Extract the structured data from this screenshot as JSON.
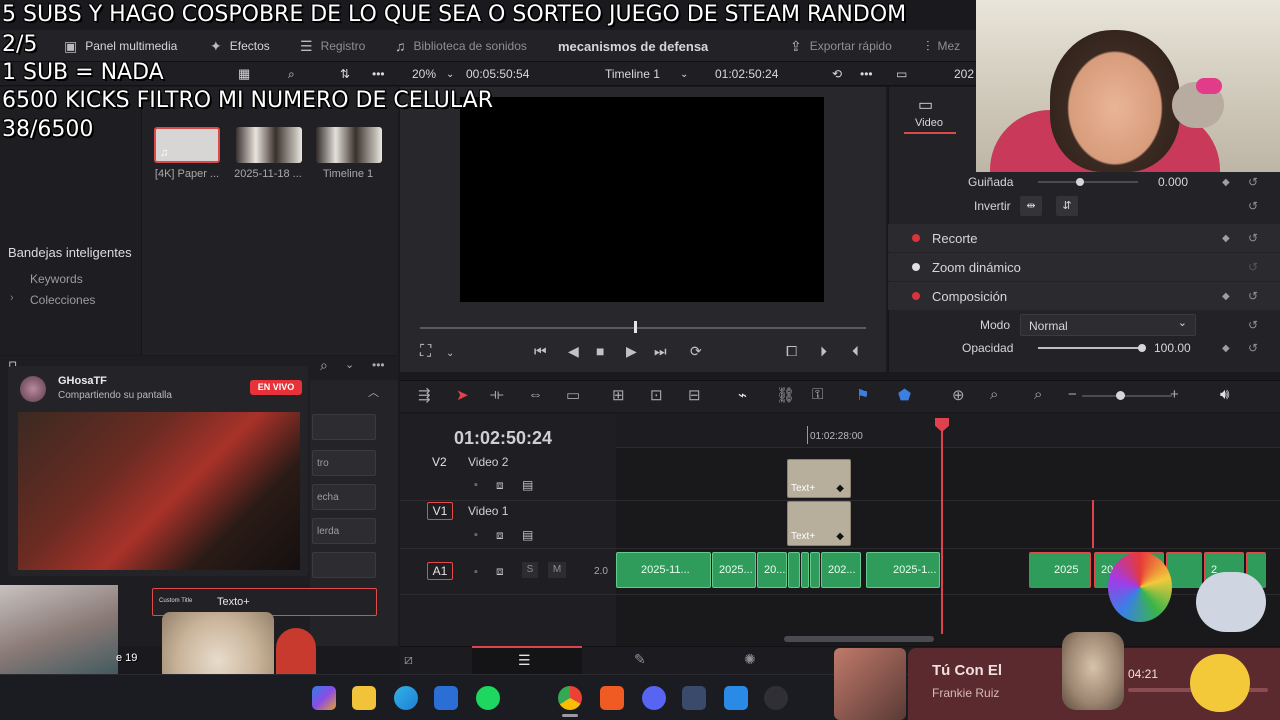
{
  "overlay": {
    "line1": "5 SUBS Y HAGO COSPOBRE DE LO QUE SEA O SORTEO JUEGO DE STEAM RANDOM",
    "line2": "2/5",
    "line3": "1 SUB = NADA",
    "line4": "6500 KICKS FILTRO MI NUMERO DE CELULAR",
    "line5": "38/6500"
  },
  "toolbar": {
    "panel_multimedia": "Panel multimedia",
    "efectos": "Efectos",
    "registro": "Registro",
    "biblioteca": "Biblioteca de sonidos",
    "project_name": "mecanismos de defensa",
    "exportar": "Exportar rápido",
    "mezclador": "Mez"
  },
  "bar2": {
    "zoom": "20%",
    "source_tc": "00:05:50:54",
    "timeline_name": "Timeline 1",
    "timeline_tc": "01:02:50:24",
    "right_partial": "202"
  },
  "media_pool": {
    "thumbs": [
      {
        "label": "[4K] Paper ..."
      },
      {
        "label": "2025-11-18 ..."
      },
      {
        "label": "Timeline 1"
      }
    ],
    "smart_bins_title": "Bandejas inteligentes",
    "bins": [
      "Keywords",
      "Colecciones"
    ]
  },
  "inspector": {
    "tab_video": "Video",
    "guinada_label": "Guiñada",
    "guinada_value": "0.000",
    "invertir_label": "Invertir",
    "recorte": "Recorte",
    "zoom_dinamico": "Zoom dinámico",
    "composicion": "Composición",
    "modo_label": "Modo",
    "modo_value": "Normal",
    "opacidad_label": "Opacidad",
    "opacidad_value": "100.00"
  },
  "timeline": {
    "timecode": "01:02:50:24",
    "ruler_label": "01:02:28:00",
    "tracks": [
      {
        "id": "V2",
        "name": "Video 2"
      },
      {
        "id": "V1",
        "name": "Video 1"
      },
      {
        "id": "A1",
        "name": "",
        "level": "2.0"
      }
    ],
    "text_clip": "Text+",
    "audio_clips": [
      "2025-11...",
      "2025...",
      "20...",
      "202...",
      "2025-1...",
      "2025",
      "20",
      "2"
    ],
    "s_label": "S",
    "m_label": "M"
  },
  "stream": {
    "user": "GHosaTF",
    "status": "Compartiendo su pantalla",
    "badge": "EN VIVO"
  },
  "fx_list": [
    "tro",
    "echa",
    "lerda"
  ],
  "custom_title": {
    "small": "Custom Title",
    "name": "Texto+"
  },
  "sticker": {
    "text": "e 19"
  },
  "music": {
    "title": "Tú Con El",
    "artist": "Frankie Ruiz",
    "time": "04:21"
  },
  "colors": {
    "accent_red": "#e0424d",
    "audio_green": "#2f9c5c",
    "badge_red": "#e8323a"
  }
}
